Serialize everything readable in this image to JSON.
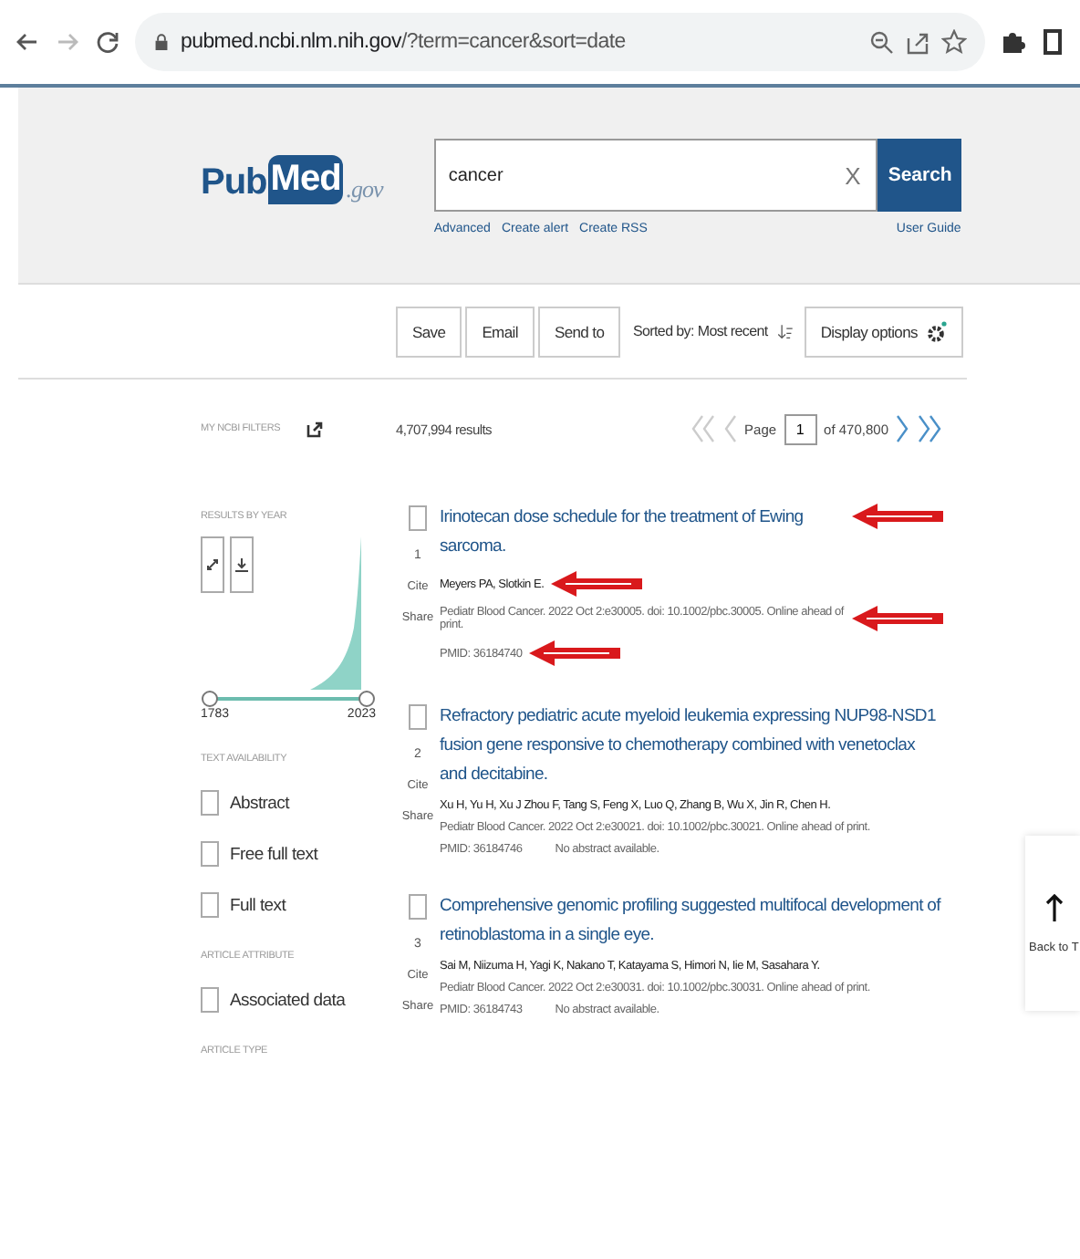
{
  "browser": {
    "url_host": "pubmed.ncbi.nlm.nih.gov",
    "url_path": "/?term=cancer&sort=date"
  },
  "header": {
    "logo": {
      "pub": "Pub",
      "med": "Med",
      "gov": ".gov"
    },
    "search_value": "cancer",
    "clear": "X",
    "search_button": "Search",
    "links": [
      "Advanced",
      "Create alert",
      "Create RSS"
    ],
    "user_guide": "User Guide"
  },
  "toolbar": {
    "buttons": [
      "Save",
      "Email",
      "Send to"
    ],
    "sorted_by": "Sorted by: Most recent",
    "display_options": "Display options"
  },
  "sidebar": {
    "my_filters": "MY NCBI FILTERS",
    "results_by_year": "RESULTS BY YEAR",
    "slider_thumbs": [
      {
        "level": 0
      },
      {
        "level": 1
      }
    ],
    "year_start": "1783",
    "year_end": "2023",
    "sections": [
      {
        "heading": "TEXT AVAILABILITY",
        "filters": [
          {
            "label": "Abstract",
            "checked": false
          },
          {
            "label": "Free full text",
            "checked": false
          },
          {
            "label": "Full text",
            "checked": false
          }
        ]
      },
      {
        "heading": "ARTICLE ATTRIBUTE",
        "filters": [
          {
            "label": "Associated data",
            "checked": false
          }
        ]
      },
      {
        "heading": "ARTICLE TYPE"
      }
    ]
  },
  "results_header": {
    "count": "4,707,994 results",
    "page_label": "Page",
    "page_value": "1",
    "page_total": "of 470,800",
    "first_disabled": true,
    "prev_disabled": true,
    "next_disabled": false,
    "last_disabled": false
  },
  "results": [
    {
      "number": "1",
      "title": "Irinotecan dose schedule for the treatment of Ewing sarcoma.",
      "authors": "Meyers PA, Slotkin E.",
      "journal": "Pediatr Blood Cancer. 2022 Oct 2:e30005. doi: 10.1002/pbc.30005. Online ahead of print.",
      "pmid": "PMID: 36184740",
      "actions": [
        "Cite",
        "Share"
      ],
      "checked": false,
      "annotated": true
    },
    {
      "number": "2",
      "title": "Refractory pediatric acute myeloid leukemia expressing NUP98-NSD1 fusion gene responsive to chemotherapy combined with venetoclax and decitabine.",
      "authors": "Xu H, Yu H, Xu J Zhou F, Tang S, Feng X, Luo Q, Zhang B, Wu X, Jin R, Chen H.",
      "journal": "Pediatr Blood Cancer. 2022 Oct 2:e30021. doi: 10.1002/pbc.30021. Online ahead of print.",
      "pmid": "PMID: 36184746",
      "note": "No abstract available.",
      "actions": [
        "Cite",
        "Share"
      ],
      "checked": false,
      "annotated": false
    },
    {
      "number": "3",
      "title": "Comprehensive genomic profiling suggested multifocal development of retinoblastoma in a single eye.",
      "authors": "Sai M, Niizuma H, Yagi K, Nakano T, Katayama S, Himori N, Iie M, Sasahara Y.",
      "journal": "Pediatr Blood Cancer. 2022 Oct 2:e30031. doi: 10.1002/pbc.30031. Online ahead of print.",
      "pmid": "PMID: 36184743",
      "note": "No abstract available.",
      "actions": [
        "Cite",
        "Share"
      ],
      "checked": false,
      "annotated": false
    }
  ],
  "back_to_top": "Back to T"
}
